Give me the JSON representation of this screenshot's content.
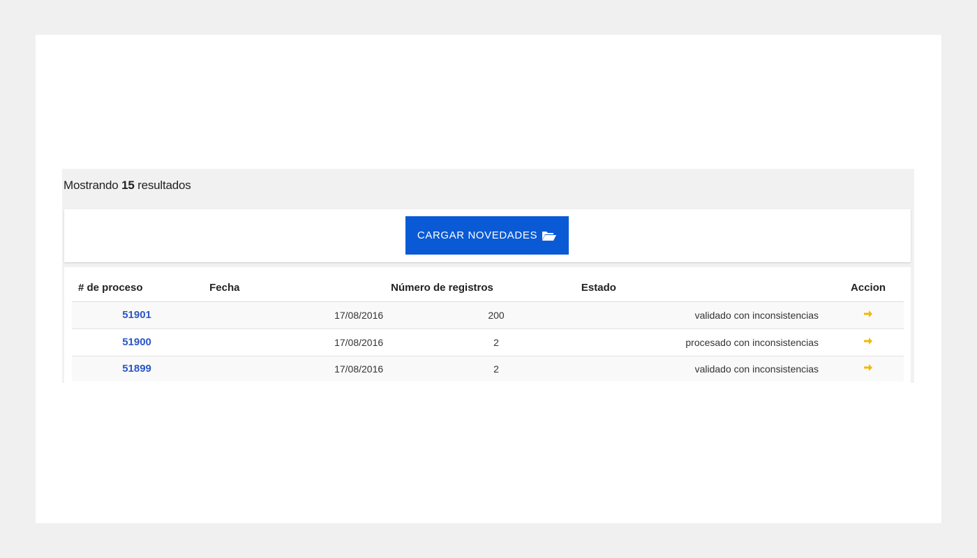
{
  "summary": {
    "prefix": "Mostrando",
    "count": "15",
    "suffix": "resultados"
  },
  "upload_button": {
    "label": "CARGAR NOVEDADES",
    "icon": "folder-open-icon",
    "color": "#0a5ad6"
  },
  "table": {
    "headers": {
      "proceso": "# de proceso",
      "fecha": "Fecha",
      "registros": "Número de registros",
      "estado": "Estado",
      "accion": "Accion"
    },
    "rows": [
      {
        "proceso": "51901",
        "fecha": "17/08/2016",
        "registros": "200",
        "estado": "validado con inconsistencias",
        "accion_icon": "arrow-right-icon"
      },
      {
        "proceso": "51900",
        "fecha": "17/08/2016",
        "registros": "2",
        "estado": "procesado con inconsistencias",
        "accion_icon": "arrow-right-icon"
      },
      {
        "proceso": "51899",
        "fecha": "17/08/2016",
        "registros": "2",
        "estado": "validado con inconsistencias",
        "accion_icon": "arrow-right-icon"
      }
    ],
    "link_color": "#2a56c6",
    "action_color": "#f5b800"
  }
}
